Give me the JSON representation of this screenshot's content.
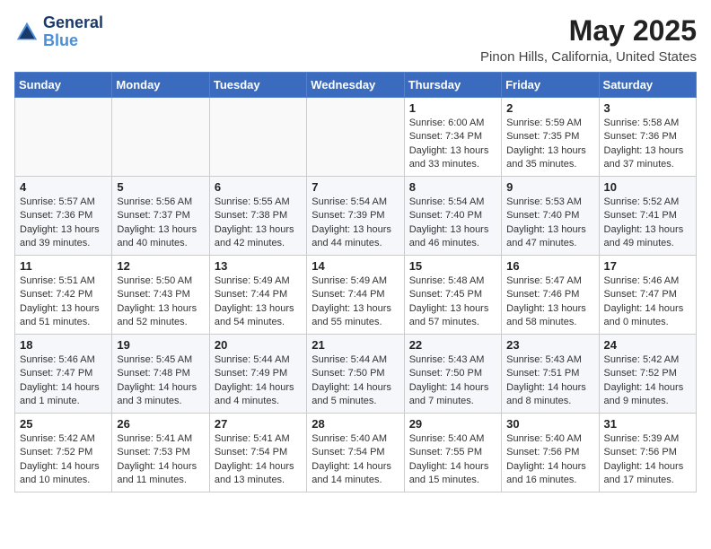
{
  "header": {
    "logo_line1": "General",
    "logo_line2": "Blue",
    "title": "May 2025",
    "subtitle": "Pinon Hills, California, United States"
  },
  "weekdays": [
    "Sunday",
    "Monday",
    "Tuesday",
    "Wednesday",
    "Thursday",
    "Friday",
    "Saturday"
  ],
  "weeks": [
    [
      {
        "day": "",
        "info": ""
      },
      {
        "day": "",
        "info": ""
      },
      {
        "day": "",
        "info": ""
      },
      {
        "day": "",
        "info": ""
      },
      {
        "day": "1",
        "info": "Sunrise: 6:00 AM\nSunset: 7:34 PM\nDaylight: 13 hours\nand 33 minutes."
      },
      {
        "day": "2",
        "info": "Sunrise: 5:59 AM\nSunset: 7:35 PM\nDaylight: 13 hours\nand 35 minutes."
      },
      {
        "day": "3",
        "info": "Sunrise: 5:58 AM\nSunset: 7:36 PM\nDaylight: 13 hours\nand 37 minutes."
      }
    ],
    [
      {
        "day": "4",
        "info": "Sunrise: 5:57 AM\nSunset: 7:36 PM\nDaylight: 13 hours\nand 39 minutes."
      },
      {
        "day": "5",
        "info": "Sunrise: 5:56 AM\nSunset: 7:37 PM\nDaylight: 13 hours\nand 40 minutes."
      },
      {
        "day": "6",
        "info": "Sunrise: 5:55 AM\nSunset: 7:38 PM\nDaylight: 13 hours\nand 42 minutes."
      },
      {
        "day": "7",
        "info": "Sunrise: 5:54 AM\nSunset: 7:39 PM\nDaylight: 13 hours\nand 44 minutes."
      },
      {
        "day": "8",
        "info": "Sunrise: 5:54 AM\nSunset: 7:40 PM\nDaylight: 13 hours\nand 46 minutes."
      },
      {
        "day": "9",
        "info": "Sunrise: 5:53 AM\nSunset: 7:40 PM\nDaylight: 13 hours\nand 47 minutes."
      },
      {
        "day": "10",
        "info": "Sunrise: 5:52 AM\nSunset: 7:41 PM\nDaylight: 13 hours\nand 49 minutes."
      }
    ],
    [
      {
        "day": "11",
        "info": "Sunrise: 5:51 AM\nSunset: 7:42 PM\nDaylight: 13 hours\nand 51 minutes."
      },
      {
        "day": "12",
        "info": "Sunrise: 5:50 AM\nSunset: 7:43 PM\nDaylight: 13 hours\nand 52 minutes."
      },
      {
        "day": "13",
        "info": "Sunrise: 5:49 AM\nSunset: 7:44 PM\nDaylight: 13 hours\nand 54 minutes."
      },
      {
        "day": "14",
        "info": "Sunrise: 5:49 AM\nSunset: 7:44 PM\nDaylight: 13 hours\nand 55 minutes."
      },
      {
        "day": "15",
        "info": "Sunrise: 5:48 AM\nSunset: 7:45 PM\nDaylight: 13 hours\nand 57 minutes."
      },
      {
        "day": "16",
        "info": "Sunrise: 5:47 AM\nSunset: 7:46 PM\nDaylight: 13 hours\nand 58 minutes."
      },
      {
        "day": "17",
        "info": "Sunrise: 5:46 AM\nSunset: 7:47 PM\nDaylight: 14 hours\nand 0 minutes."
      }
    ],
    [
      {
        "day": "18",
        "info": "Sunrise: 5:46 AM\nSunset: 7:47 PM\nDaylight: 14 hours\nand 1 minute."
      },
      {
        "day": "19",
        "info": "Sunrise: 5:45 AM\nSunset: 7:48 PM\nDaylight: 14 hours\nand 3 minutes."
      },
      {
        "day": "20",
        "info": "Sunrise: 5:44 AM\nSunset: 7:49 PM\nDaylight: 14 hours\nand 4 minutes."
      },
      {
        "day": "21",
        "info": "Sunrise: 5:44 AM\nSunset: 7:50 PM\nDaylight: 14 hours\nand 5 minutes."
      },
      {
        "day": "22",
        "info": "Sunrise: 5:43 AM\nSunset: 7:50 PM\nDaylight: 14 hours\nand 7 minutes."
      },
      {
        "day": "23",
        "info": "Sunrise: 5:43 AM\nSunset: 7:51 PM\nDaylight: 14 hours\nand 8 minutes."
      },
      {
        "day": "24",
        "info": "Sunrise: 5:42 AM\nSunset: 7:52 PM\nDaylight: 14 hours\nand 9 minutes."
      }
    ],
    [
      {
        "day": "25",
        "info": "Sunrise: 5:42 AM\nSunset: 7:52 PM\nDaylight: 14 hours\nand 10 minutes."
      },
      {
        "day": "26",
        "info": "Sunrise: 5:41 AM\nSunset: 7:53 PM\nDaylight: 14 hours\nand 11 minutes."
      },
      {
        "day": "27",
        "info": "Sunrise: 5:41 AM\nSunset: 7:54 PM\nDaylight: 14 hours\nand 13 minutes."
      },
      {
        "day": "28",
        "info": "Sunrise: 5:40 AM\nSunset: 7:54 PM\nDaylight: 14 hours\nand 14 minutes."
      },
      {
        "day": "29",
        "info": "Sunrise: 5:40 AM\nSunset: 7:55 PM\nDaylight: 14 hours\nand 15 minutes."
      },
      {
        "day": "30",
        "info": "Sunrise: 5:40 AM\nSunset: 7:56 PM\nDaylight: 14 hours\nand 16 minutes."
      },
      {
        "day": "31",
        "info": "Sunrise: 5:39 AM\nSunset: 7:56 PM\nDaylight: 14 hours\nand 17 minutes."
      }
    ]
  ]
}
